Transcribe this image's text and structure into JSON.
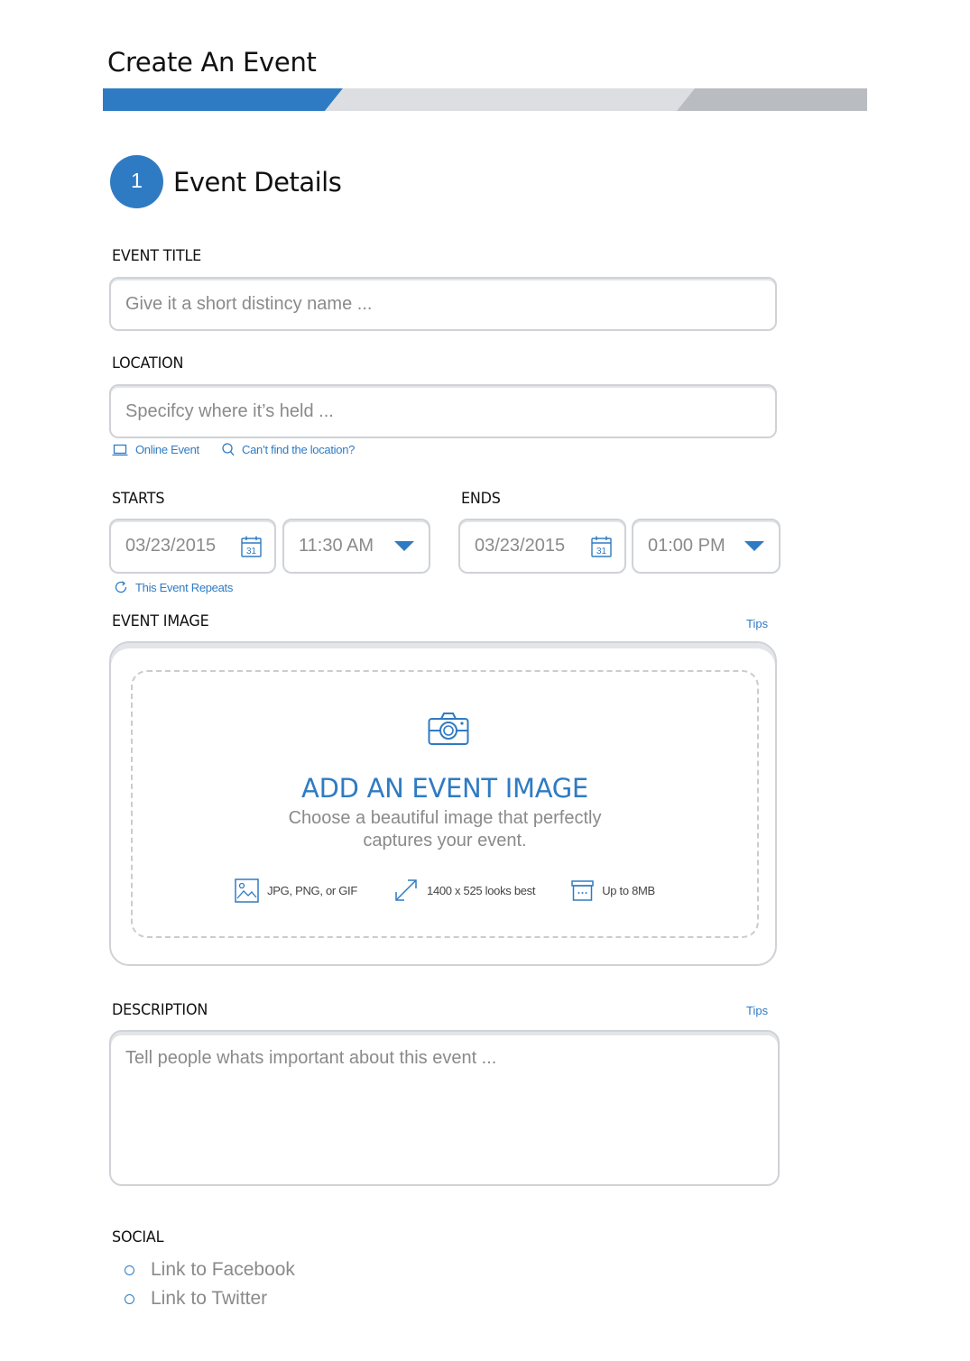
{
  "page": {
    "title": "Create An Event",
    "progress_active_color": "#2f7bc3",
    "progress_mid_color": "#dcdee1",
    "progress_end_color": "#b9bcc0"
  },
  "step": {
    "number": "1",
    "label": "Event Details"
  },
  "event_title": {
    "label": "EVENT TITLE",
    "placeholder": "Give it a short distincy name ..."
  },
  "location": {
    "label": "LOCATION",
    "placeholder": "Specifcy where it’s held ...",
    "online_event": "Online Event",
    "cant_find": "Can’t find the location?"
  },
  "starts": {
    "label": "STARTS",
    "date": "03/23/2015",
    "time": "11:30 AM",
    "calendar_day": "31"
  },
  "ends": {
    "label": "ENDS",
    "date": "03/23/2015",
    "time": "01:00 PM",
    "calendar_day": "31"
  },
  "repeats": {
    "label": "This Event Repeats"
  },
  "event_image": {
    "label": "EVENT IMAGE",
    "tips": "Tips",
    "title": "ADD AN EVENT IMAGE",
    "subtitle_line1": "Choose a beautiful image that perfectly",
    "subtitle_line2": "captures your event.",
    "spec_formats": "JPG, PNG, or GIF",
    "spec_size": "1400 x 525 looks best",
    "spec_max": "Up to 8MB"
  },
  "description": {
    "label": "DESCRIPTION",
    "tips": "Tips",
    "placeholder": "Tell people whats important about this event ..."
  },
  "social": {
    "label": "SOCIAL",
    "items": [
      {
        "label": "Link to Facebook"
      },
      {
        "label": "Link to Twitter"
      }
    ]
  },
  "icons": {
    "online_event": "laptop-icon",
    "cant_find": "search-icon",
    "date": "calendar-icon",
    "time_dropdown": "caret-down-icon",
    "repeats": "refresh-icon",
    "upload": "camera-icon",
    "formats": "image-icon",
    "size": "resize-icon",
    "max": "archive-icon",
    "social_bullet": "circle-bullet-icon"
  }
}
